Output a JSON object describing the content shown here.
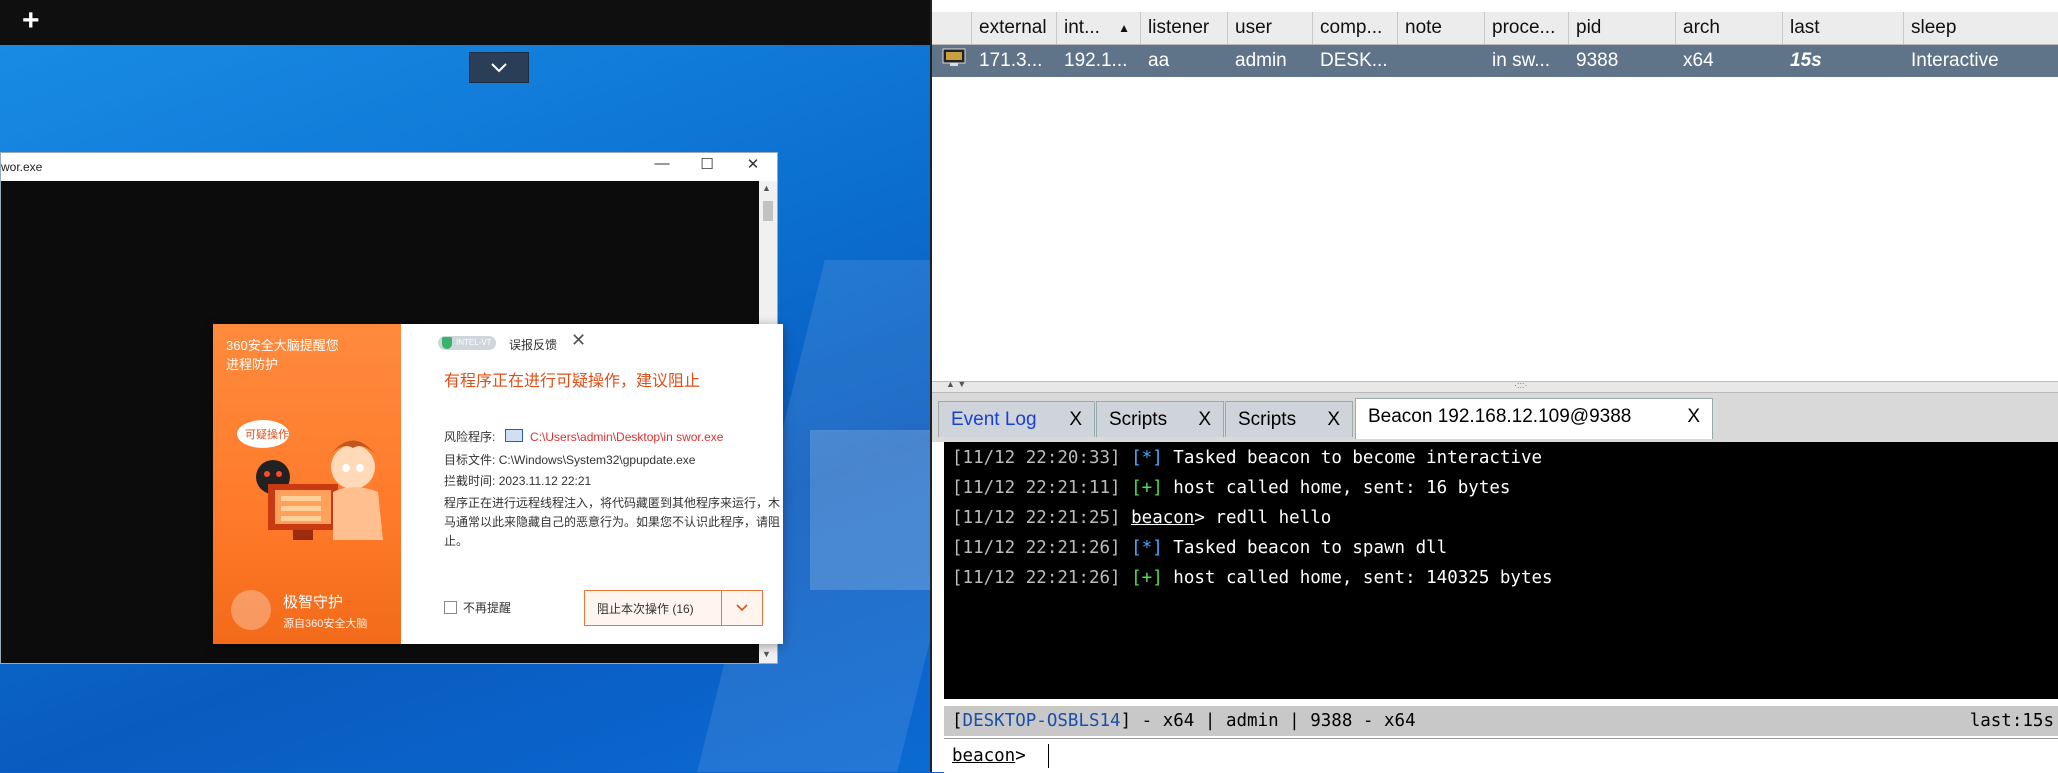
{
  "desktop": {
    "plus_icon": "+",
    "console_window": {
      "title": "wor.exe",
      "controls": {
        "minimize": "—",
        "maximize": "☐",
        "close": "✕"
      }
    },
    "popup": {
      "brand_line1": "360安全大脑提醒您",
      "brand_line2": "进程防护",
      "stamp": "可疑操作",
      "badge": "INTEL-VT",
      "feedback": "误报反馈",
      "headline": "有程序正在进行可疑操作，建议阻止",
      "risk_label": "风险程序:",
      "risk_value": "C:\\Users\\admin\\Desktop\\in swor.exe",
      "target_label": "目标文件:",
      "target_value": "C:\\Windows\\System32\\gpupdate.exe",
      "time_label": "拦截时间:",
      "time_value": "2023.11.12 22:21",
      "description": "程序正在进行远程线程注入，将代码藏匿到其他程序来运行，木马通常以此来隐藏自己的恶意行为。如果您不认识此程序，请阻止。",
      "no_remind": "不再提醒",
      "block_button": "阻止本次操作 (16)",
      "footer_title": "极智守护",
      "footer_sub": "源自360安全大脑"
    }
  },
  "beacon_table": {
    "columns": [
      "",
      "external",
      "int...",
      "listener",
      "user",
      "comp...",
      "note",
      "proce...",
      "pid",
      "arch",
      "last",
      "sleep"
    ],
    "sort_indicator": "▲",
    "rows": [
      {
        "external": "171.3...",
        "internal": "192.1...",
        "listener": "aa",
        "user": "admin",
        "computer": "DESK...",
        "note": "",
        "process": "in sw...",
        "pid": "9388",
        "arch": "x64",
        "last": "15s",
        "sleep": "Interactive"
      }
    ]
  },
  "tabs": [
    {
      "label": "Event Log",
      "close": "X",
      "color": "#1a3fd6"
    },
    {
      "label": "Scripts",
      "close": "X"
    },
    {
      "label": "Scripts",
      "close": "X"
    },
    {
      "label": "Beacon 192.168.12.109@9388",
      "close": "X",
      "active": true
    }
  ],
  "console": {
    "lines": [
      {
        "ts": "[11/12 22:20:33]",
        "tag": "[*]",
        "msg": "Tasked beacon to become interactive"
      },
      {
        "ts": "[11/12 22:21:11]",
        "tag": "[+]",
        "msg": "host called home, sent: 16 bytes"
      },
      {
        "ts": "[11/12 22:21:25]",
        "prompt": "beacon",
        "msg": "> redll hello"
      },
      {
        "ts": "[11/12 22:21:26]",
        "tag": "[*]",
        "msg": "Tasked beacon to spawn dll"
      },
      {
        "ts": "[11/12 22:21:26]",
        "tag": "[+]",
        "msg": "host called home, sent: 140325 bytes"
      }
    ],
    "status_host": "DESKTOP-OSBLS14",
    "status_rest": "] - x64 |  admin | 9388 - x64",
    "status_last": "last:15s",
    "prompt": "beacon",
    "prompt_suffix": ">"
  }
}
